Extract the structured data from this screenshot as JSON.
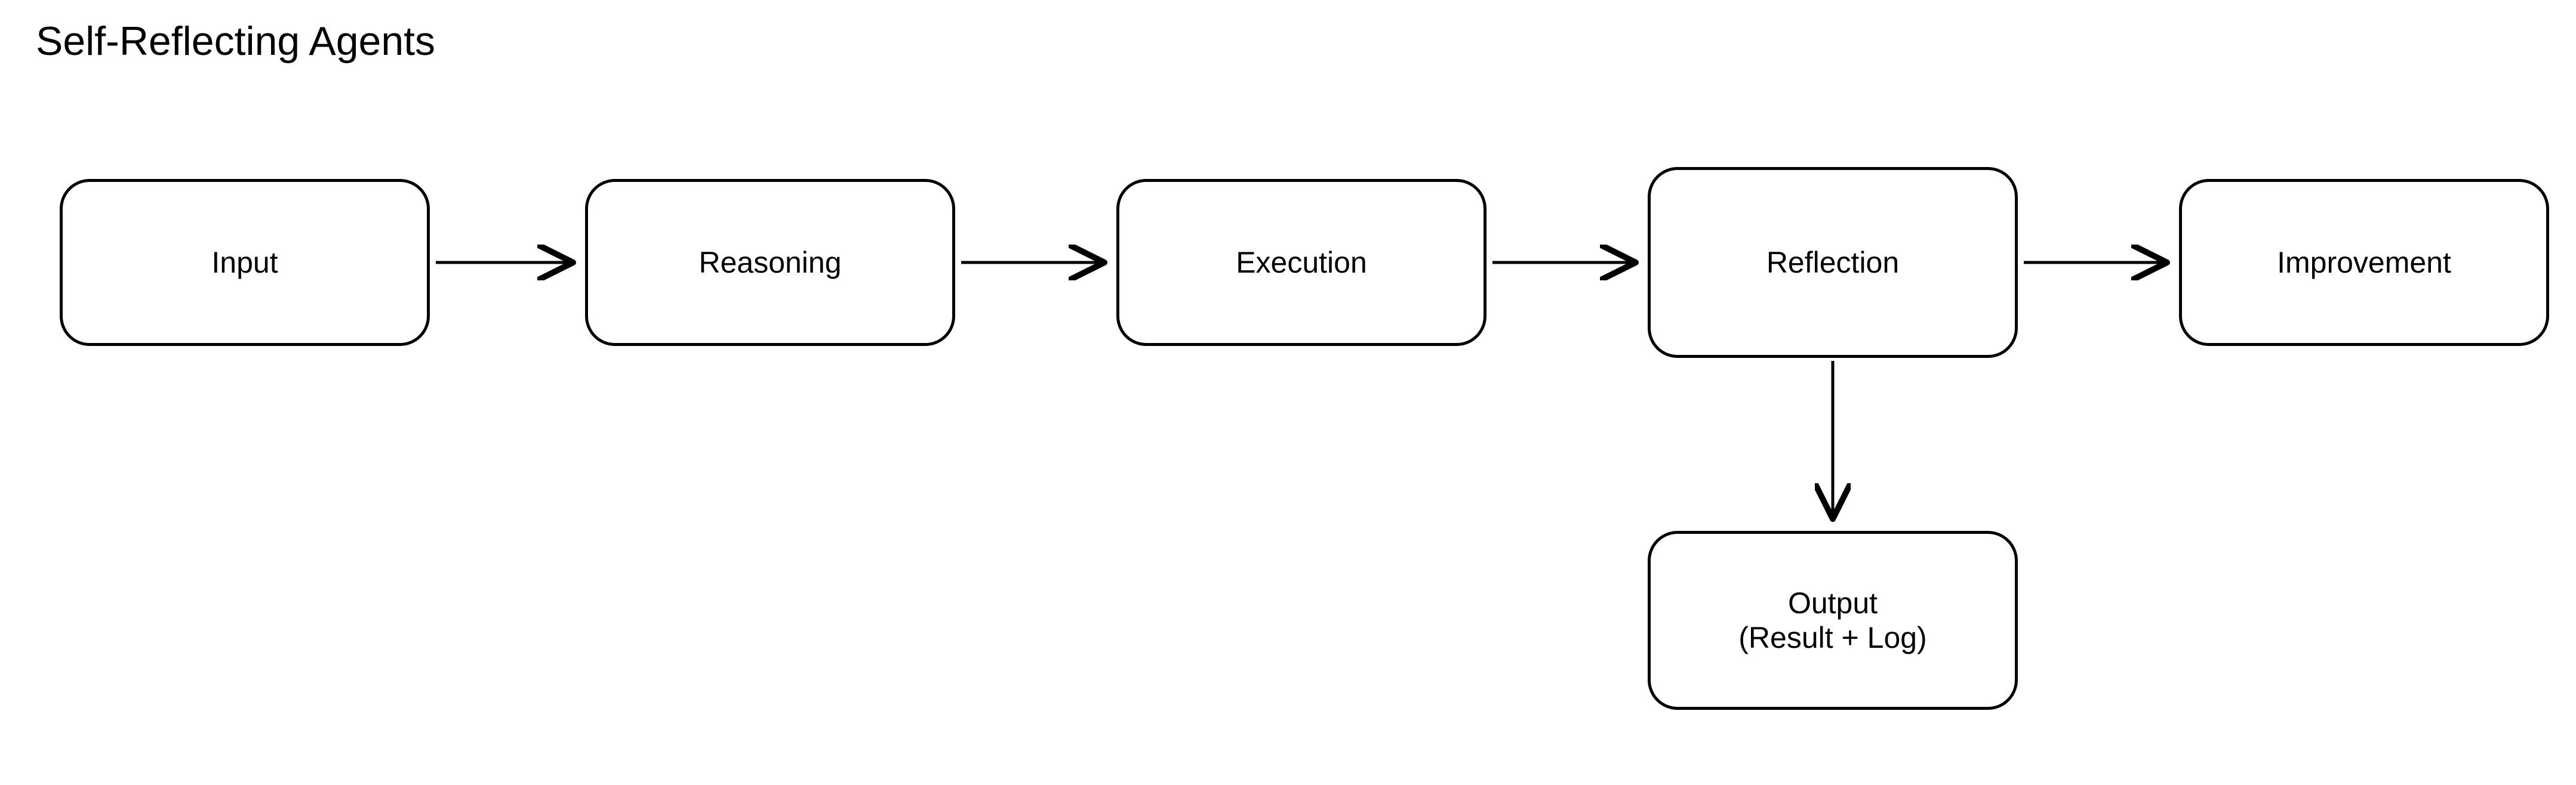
{
  "title": "Self-Reflecting Agents",
  "nodes": {
    "input": "Input",
    "reasoning": "Reasoning",
    "execution": "Execution",
    "reflection": "Reflection",
    "improvement": "Improvement",
    "output_line1": "Output",
    "output_line2": "(Result + Log)"
  },
  "edges": [
    {
      "from": "input",
      "to": "reasoning"
    },
    {
      "from": "reasoning",
      "to": "execution"
    },
    {
      "from": "execution",
      "to": "reflection"
    },
    {
      "from": "reflection",
      "to": "improvement"
    },
    {
      "from": "reflection",
      "to": "output"
    }
  ]
}
